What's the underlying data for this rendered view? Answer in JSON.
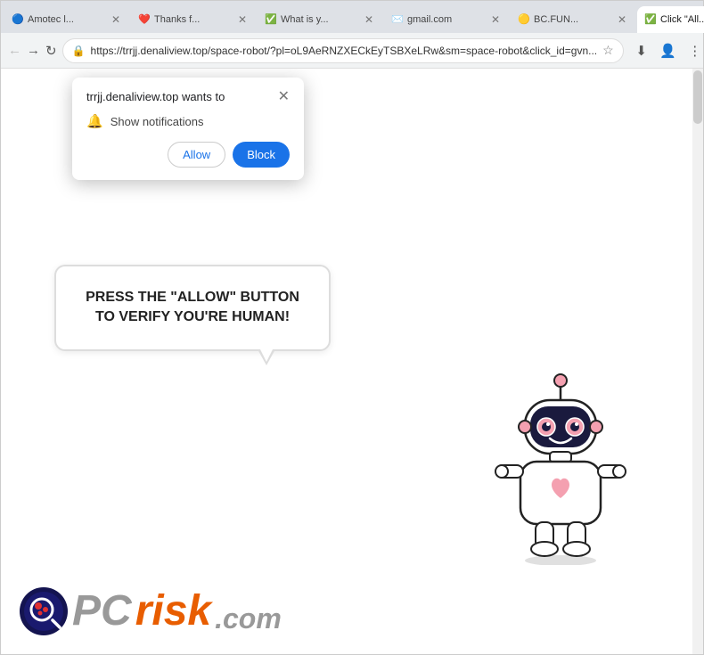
{
  "browser": {
    "tabs": [
      {
        "id": "tab1",
        "label": "Amotec l...",
        "favicon": "🔵",
        "active": false
      },
      {
        "id": "tab2",
        "label": "Thanks f...",
        "favicon": "❤️",
        "active": false
      },
      {
        "id": "tab3",
        "label": "What is y...",
        "favicon": "✅",
        "active": false
      },
      {
        "id": "tab4",
        "label": "gmail.com",
        "favicon": "✉️",
        "active": false
      },
      {
        "id": "tab5",
        "label": "BC.FUN...",
        "favicon": "🟡",
        "active": false
      },
      {
        "id": "tab6",
        "label": "Click \"All...",
        "favicon": "✅",
        "active": true
      }
    ],
    "url": "https://trrjj.denaliview.top/space-robot/?pl=oL9AeRNZXECkEyTSBXeLRw&sm=space-robot&click_id=gvn...",
    "window_controls": {
      "minimize": "—",
      "maximize": "□",
      "close": "✕"
    }
  },
  "popup": {
    "title": "trrjj.denaliview.top wants to",
    "close_icon": "✕",
    "notification_text": "Show notifications",
    "allow_label": "Allow",
    "block_label": "Block"
  },
  "page": {
    "speech_text": "PRESS THE \"ALLOW\" BUTTON TO VERIFY YOU'RE HUMAN!",
    "pcrisk_label": "PC",
    "pcrisk_risk": "risk",
    "pcrisk_dotcom": ".com"
  }
}
